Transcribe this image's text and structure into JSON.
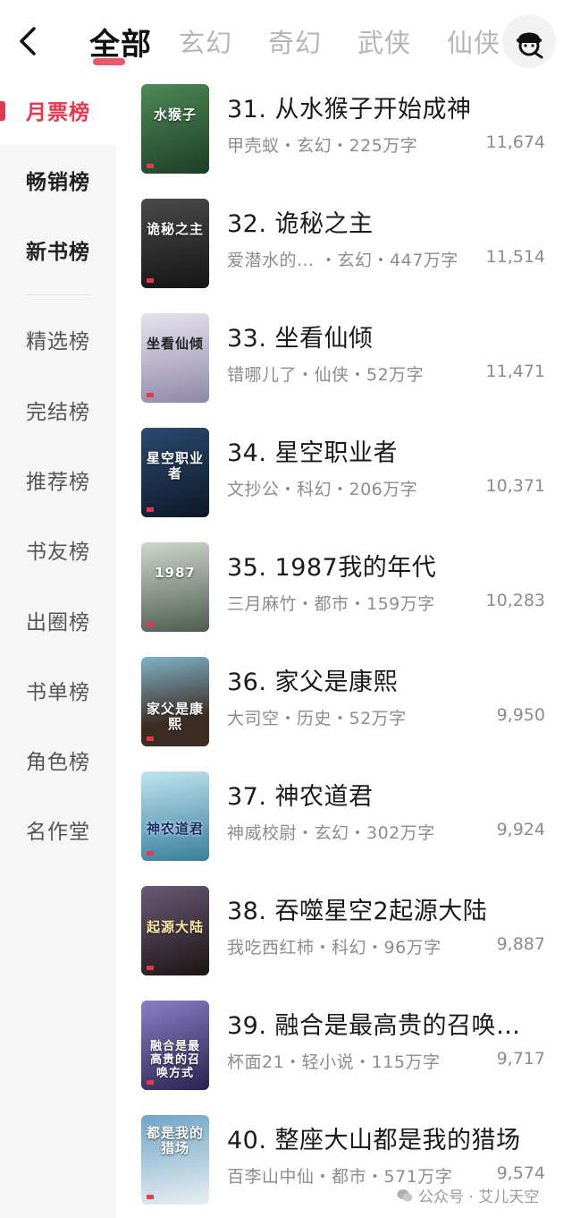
{
  "header": {
    "tabs": [
      {
        "label": "全部",
        "active": true
      },
      {
        "label": "玄幻"
      },
      {
        "label": "奇幻"
      },
      {
        "label": "武侠"
      },
      {
        "label": "仙侠"
      }
    ],
    "back_icon": "chevron-left-icon",
    "profile_icon": "reader-avatar-icon"
  },
  "sidebar": {
    "items": [
      {
        "label": "月票榜",
        "selected": true
      },
      {
        "label": "畅销榜",
        "bold": true
      },
      {
        "label": "新书榜",
        "bold": true
      },
      {
        "label": "精选榜"
      },
      {
        "label": "完结榜"
      },
      {
        "label": "推荐榜"
      },
      {
        "label": "书友榜"
      },
      {
        "label": "出圈榜"
      },
      {
        "label": "书单榜"
      },
      {
        "label": "角色榜"
      },
      {
        "label": "名作堂"
      }
    ]
  },
  "books": [
    {
      "title": "31. 从水猴子开始成神",
      "meta": "甲壳蚁・玄幻・225万字",
      "count": "11,674",
      "cover_text": "水猴子",
      "cover_color": "#2e5a3a"
    },
    {
      "title": "32. 诡秘之主",
      "meta": "爱潜水的…  ・玄幻・447万字",
      "count": "11,514",
      "cover_text": "诡秘之主",
      "cover_color": "#2a2a2a"
    },
    {
      "title": "33. 坐看仙倾",
      "meta": "错哪儿了・仙侠・52万字",
      "count": "11,471",
      "cover_text": "坐看仙倾",
      "cover_color": "#b9b4c8"
    },
    {
      "title": "34. 星空职业者",
      "meta": "文抄公・科幻・206万字",
      "count": "10,371",
      "cover_text": "星空职业者",
      "cover_color": "#1d2f4a"
    },
    {
      "title": "35. 1987我的年代",
      "meta": "三月麻竹・都市・159万字",
      "count": "10,283",
      "cover_text": "1987",
      "cover_color": "#6c7a6e"
    },
    {
      "title": "36. 家父是康熙",
      "meta": "大司空・历史・52万字",
      "count": "9,950",
      "cover_text": "家父是康熙",
      "cover_color": "#5a4636"
    },
    {
      "title": "37. 神农道君",
      "meta": "神威校尉・玄幻・302万字",
      "count": "9,924",
      "cover_text": "神农道君",
      "cover_color": "#3f7f9e"
    },
    {
      "title": "38. 吞噬星空2起源大陆",
      "meta": "我吃西红柿・科幻・96万字",
      "count": "9,887",
      "cover_text": "起源大陆",
      "cover_color": "#3b2d2a"
    },
    {
      "title": "39. 融合是最高贵的召唤…",
      "meta": "杯面21・轻小说・115万字",
      "count": "9,717",
      "cover_text": "融合是最高贵的召唤方式",
      "cover_color": "#4b3f7a"
    },
    {
      "title": "40. 整座大山都是我的猎场",
      "meta": "百李山中仙・都市・571万字",
      "count": "9,574",
      "cover_text": "都是我的猎场",
      "cover_color": "#3d6f8f"
    }
  ],
  "watermark": {
    "text": "公众号 · 艾儿天空",
    "icon": "wechat-icon"
  }
}
